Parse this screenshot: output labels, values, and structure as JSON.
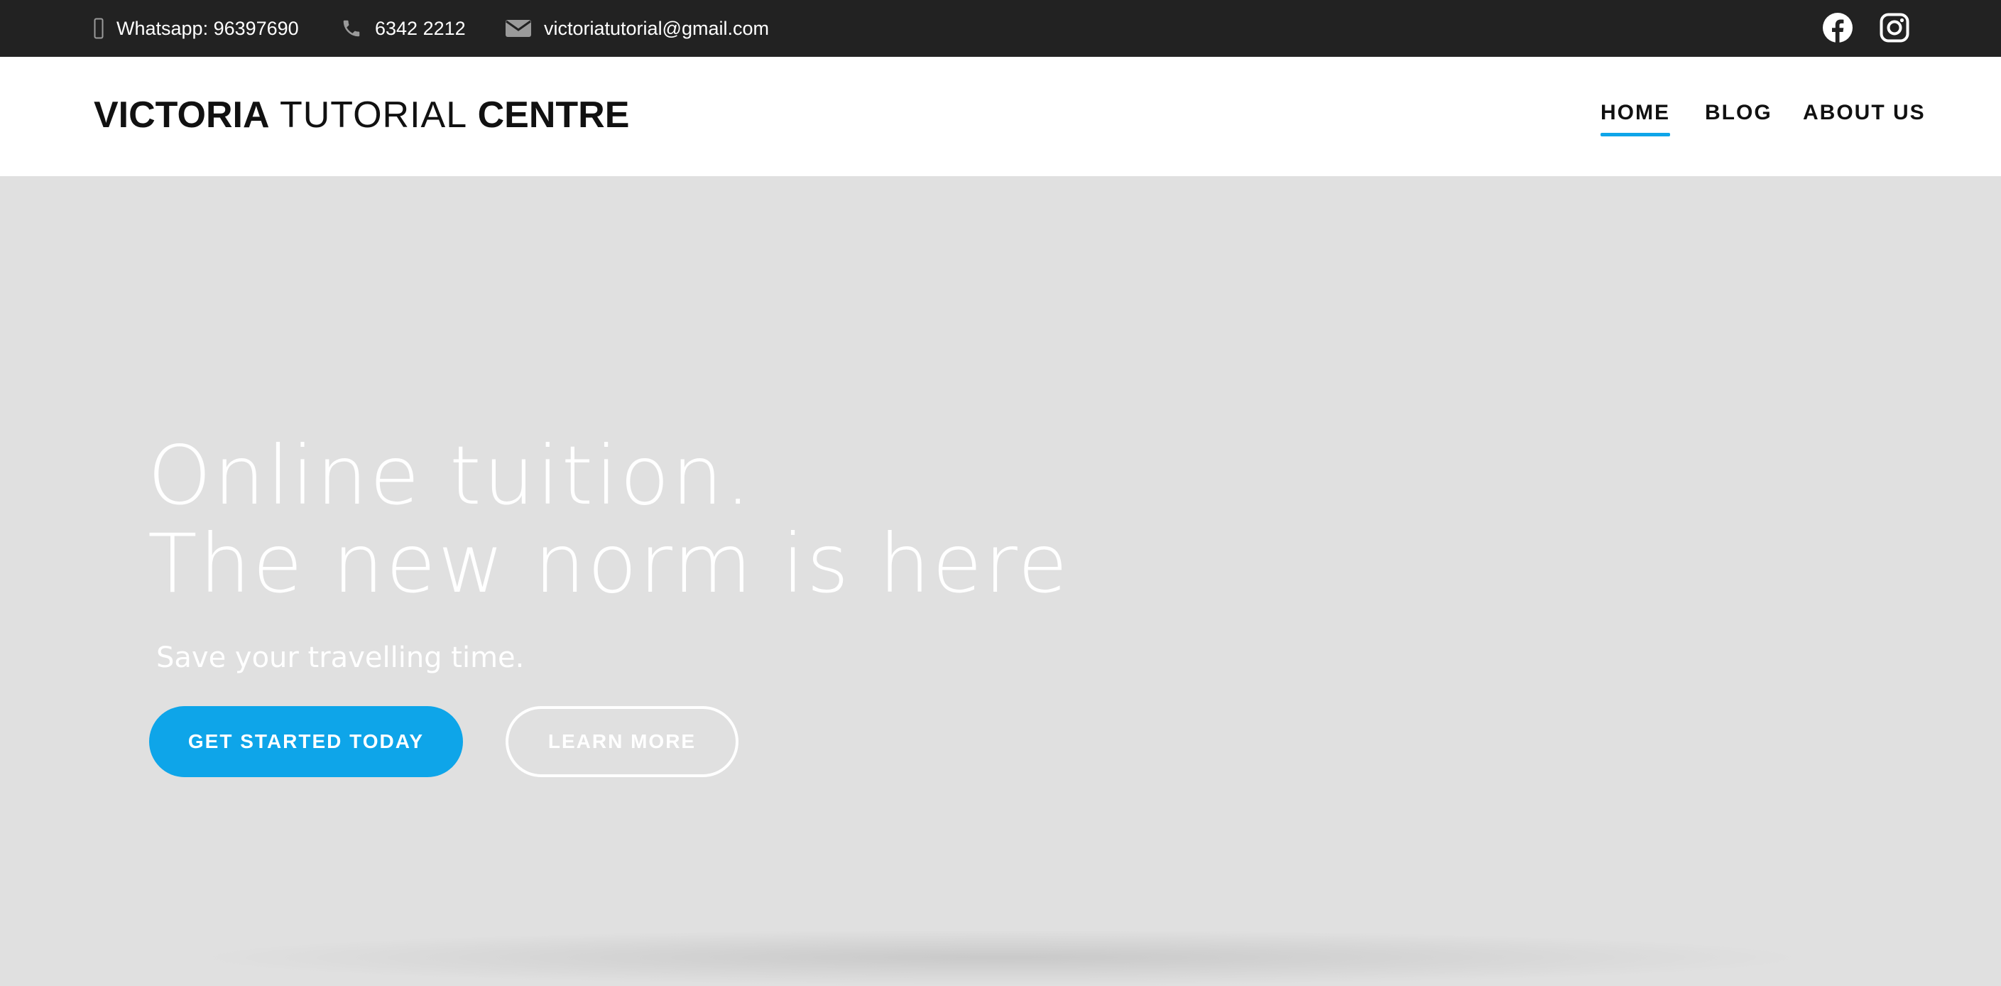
{
  "topbar": {
    "whatsapp": {
      "icon": "mobile-phone-icon",
      "text": "Whatsapp: 96397690"
    },
    "phone": {
      "icon": "phone-icon",
      "text": "6342 2212"
    },
    "email": {
      "icon": "envelope-icon",
      "text": "victoriatutorial@gmail.com"
    },
    "social": [
      {
        "icon": "facebook-icon"
      },
      {
        "icon": "instagram-icon"
      }
    ],
    "background": "#222222"
  },
  "header": {
    "brand": {
      "part1": "VICTORIA",
      "part2": "TUTORIAL",
      "part3": "CENTRE"
    },
    "nav": [
      {
        "label": "HOME",
        "active": true
      },
      {
        "label": "BLOG",
        "active": false
      },
      {
        "label": "ABOUT US",
        "active": false
      }
    ]
  },
  "hero": {
    "title_line1": "Online tuition.",
    "title_line2": "The new norm is here",
    "subtitle": "Save your travelling time.",
    "primary_button": "GET STARTED TODAY",
    "secondary_button": "LEARN MORE",
    "background": "#e0e0e0"
  },
  "colors": {
    "accent": "#0ea5e9",
    "text_dark": "#111111",
    "white": "#ffffff"
  }
}
